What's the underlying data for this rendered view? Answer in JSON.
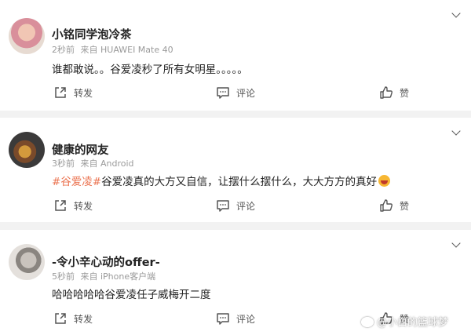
{
  "comments": [
    {
      "username": "小铭同学泡冷茶",
      "time": "2秒前",
      "source": "来自 HUAWEI Mate 40",
      "text": "谁都敢说。。谷爱凌秒了所有女明星。。。。。",
      "topic": "",
      "share_label": "转发",
      "comment_label": "评论",
      "like_label": "赞"
    },
    {
      "username": "健康的网友",
      "time": "3秒前",
      "source": "来自 Android",
      "topic": "#谷爱凌#",
      "text": "谷爱凌真的大方又自信，让摆什么摆什么，大大方方的真好",
      "share_label": "转发",
      "comment_label": "评论",
      "like_label": "赞"
    },
    {
      "username": "-令小辛心动的offer-",
      "time": "5秒前",
      "source": "来自 iPhone客户端",
      "text": "哈哈哈哈哈谷爱凌任子威梅开二度",
      "topic": "",
      "share_label": "转发",
      "comment_label": "评论",
      "like_label": "赞"
    }
  ],
  "watermark": "@小白的篮球梦",
  "icons": {
    "share": "share-icon",
    "comment": "comment-icon",
    "like": "thumbs-up-icon",
    "more": "chevron-down-icon"
  },
  "colors": {
    "topic": "#eb7350",
    "background": "#f2f2f2"
  }
}
